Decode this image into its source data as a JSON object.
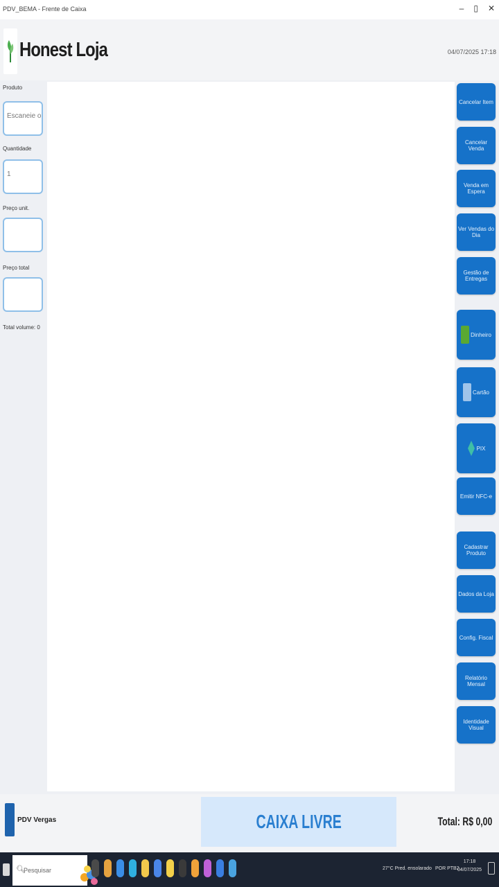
{
  "window": {
    "title": "PDV_BEMA - Frente de Caixa",
    "controls": [
      "–",
      "▯",
      "✕"
    ]
  },
  "header": {
    "brand": "Honest Loja",
    "datetime": "04/07/2025 17:18"
  },
  "left_panel": {
    "fields": [
      {
        "label": "Produto",
        "value": "Escaneie ou d..."
      },
      {
        "label": "Quantidade",
        "value": "1"
      },
      {
        "label": "Preço unit.",
        "value": ""
      },
      {
        "label": "Preço total",
        "value": ""
      }
    ],
    "total_items": "Total volume: 0"
  },
  "buttons": {
    "group1": [
      "Cancelar Item",
      "Cancelar Venda",
      "Venda em Espera",
      "Ver Vendas do Dia",
      "Gestão de Entregas"
    ],
    "payments": [
      {
        "label": "Dinheiro",
        "icon": "cash-icon",
        "color": "#5aa832"
      },
      {
        "label": "Cartão",
        "icon": "card-icon",
        "color": "#9fc4ea"
      },
      {
        "label": "PIX",
        "icon": "pix-icon",
        "color": "#3fbfa6"
      }
    ],
    "emit": "Emitir NFC-e",
    "group3": [
      "Cadastrar Produto",
      "Dados da Loja",
      "Config. Fiscal",
      "Relatório Mensal",
      "Identidade Visual"
    ]
  },
  "footer": {
    "pdv": "PDV Vergas",
    "status": "CAIXA LIVRE",
    "total": "Total: R$ 0,00"
  },
  "taskbar": {
    "search": "Pesquisar",
    "weather": "27°C Pred. ensolarado",
    "time": "17:18",
    "locale": "POR PTB2",
    "date": "04/07/2025",
    "app_colors": [
      "#4a4a4a",
      "#e6a340",
      "#3a8ee6",
      "#2fb0e0",
      "#f2c94c",
      "#4a86e8",
      "#f2d04a",
      "#3a3a3a",
      "#f0a23a",
      "#c061d8",
      "#3a7ee0",
      "#4aa3df"
    ]
  }
}
